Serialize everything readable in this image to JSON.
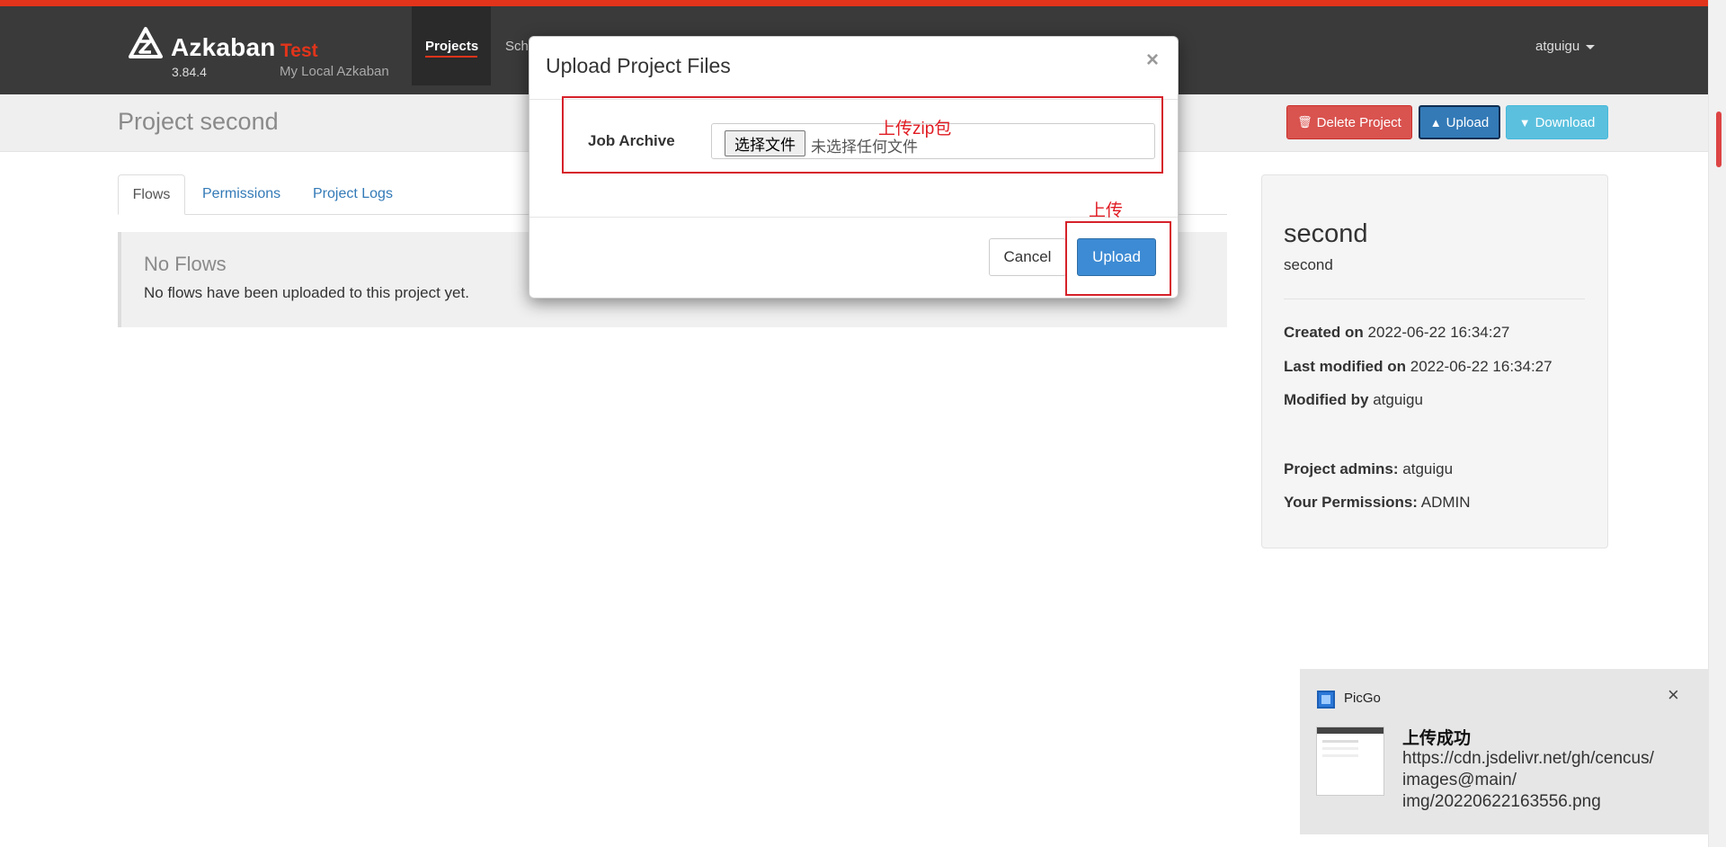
{
  "navbar": {
    "brand": "Azkaban",
    "env": "Test",
    "version": "3.84.4",
    "subtitle": "My Local Azkaban",
    "nav_projects": "Projects",
    "nav_partial": "Sch",
    "user": "atguigu"
  },
  "header": {
    "title": "Project second",
    "delete_label": "Delete Project",
    "upload_label": "Upload",
    "download_label": "Download"
  },
  "tabs": {
    "flows": "Flows",
    "permissions": "Permissions",
    "logs": "Project Logs"
  },
  "noflows": {
    "title": "No Flows",
    "text": "No flows have been uploaded to this project yet."
  },
  "project": {
    "name": "second",
    "description": "second",
    "created_label": "Created on",
    "created_value": "2022-06-22 16:34:27",
    "modified_label": "Last modified on",
    "modified_value": "2022-06-22 16:34:27",
    "modified_by_label": "Modified by",
    "modified_by_value": "atguigu",
    "admins_label": "Project admins:",
    "admins_value": "atguigu",
    "perms_label": "Your Permissions:",
    "perms_value": "ADMIN"
  },
  "modal": {
    "title": "Upload Project Files",
    "close": "×",
    "field_label": "Job Archive",
    "file_button": "选择文件",
    "file_none": "未选择任何文件",
    "cancel": "Cancel",
    "upload": "Upload"
  },
  "annotations": {
    "zip_note": "上传zip包",
    "upload_note": "上传"
  },
  "toast": {
    "app": "PicGo",
    "close": "×",
    "title": "上传成功",
    "line1": "https://cdn.jsdelivr.net/gh/cencus/",
    "line2": "images@main/",
    "line3": "img/20220622163556.png"
  },
  "colors": {
    "accent": "#e2341b",
    "navbar": "#3a3a3a",
    "primary": "#337ab7",
    "danger": "#d9534f",
    "info": "#5bc0de",
    "annotation": "#d6212a"
  }
}
